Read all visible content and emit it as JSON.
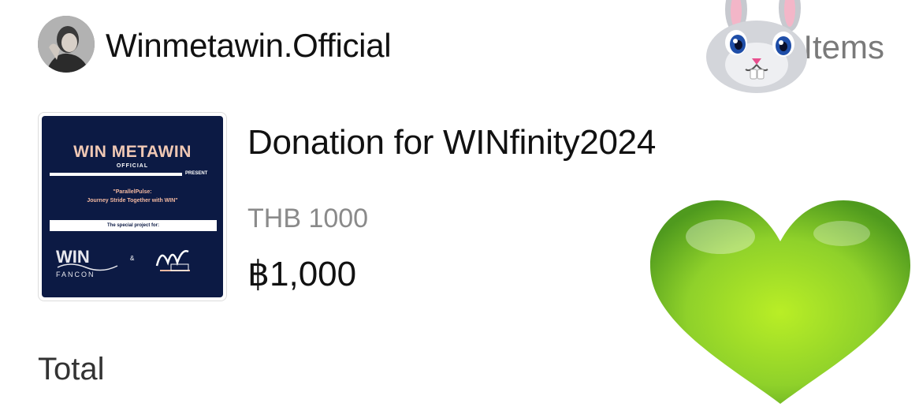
{
  "header": {
    "shop_name": "Winmetawin.Official",
    "items_label": "Items"
  },
  "product": {
    "title": "Donation for WINfinity2024",
    "variant": "THB 1000",
    "price": "฿1,000",
    "thumbnail": {
      "brand": "WIN METAWIN",
      "sub": "OFFICIAL",
      "present": "PRESENT",
      "line1": "\"ParallelPulse:",
      "line2": "Journey Stride Together with WIN\"",
      "box_text": "The special project for:",
      "amp": "&"
    }
  },
  "summary": {
    "total_label": "Total"
  },
  "stickers": {
    "bunny": "bunny-sticker",
    "heart": "green-heart-sticker"
  },
  "colors": {
    "thumb_bg": "#0c1a44",
    "heart": "#8fd12a",
    "muted_text": "#8a8a8a"
  }
}
